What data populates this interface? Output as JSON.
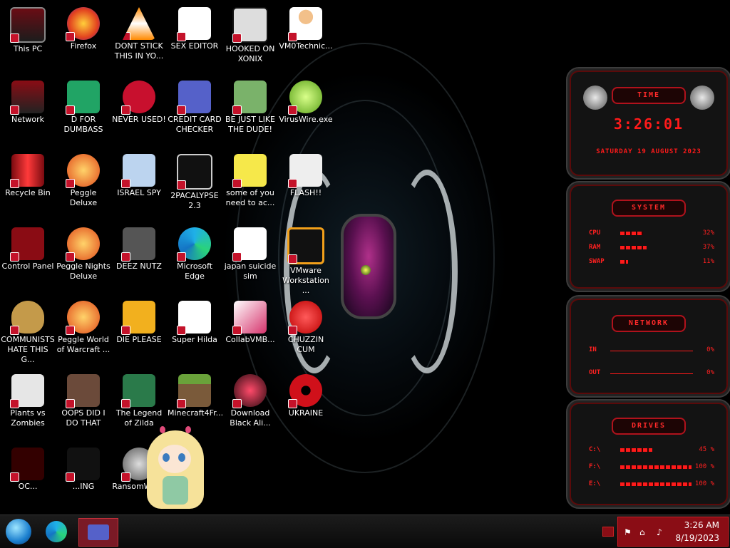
{
  "desktop": {
    "icons": [
      {
        "label": "This PC",
        "art": "monitor"
      },
      {
        "label": "Firefox",
        "art": "firefox"
      },
      {
        "label": "DONT STICK THIS IN YO...",
        "art": "vlc"
      },
      {
        "label": "SEX EDITOR",
        "art": "hxd"
      },
      {
        "label": "HOOKED ON XONIX",
        "art": "xonix"
      },
      {
        "label": "VM0Technic...",
        "art": "person"
      },
      {
        "label": "Network",
        "art": "network"
      },
      {
        "label": "D FOR DUMBASS",
        "art": "sheets"
      },
      {
        "label": "NEVER USED!",
        "art": "dev"
      },
      {
        "label": "CREDIT CARD CHECKER",
        "art": "card"
      },
      {
        "label": "BE JUST LIKE THE DUDE!",
        "art": "elf"
      },
      {
        "label": "VirusWire.exe",
        "art": "lime"
      },
      {
        "label": "Recycle Bin",
        "art": "bin"
      },
      {
        "label": "Peggle Deluxe",
        "art": "peggle"
      },
      {
        "label": "ISRAEL SPY",
        "art": "spy"
      },
      {
        "label": "2PACALYPSE 2.3",
        "art": "cmd"
      },
      {
        "label": "some of you need to ac...",
        "art": "dog"
      },
      {
        "label": "FLASH!!",
        "art": "flash"
      },
      {
        "label": "Control Panel",
        "art": "control"
      },
      {
        "label": "Peggle Nights Deluxe",
        "art": "peggle"
      },
      {
        "label": "DEEZ NUTZ",
        "art": "windows"
      },
      {
        "label": "Microsoft Edge",
        "art": "edge"
      },
      {
        "label": "japan suicide sim",
        "art": "doc"
      },
      {
        "label": "VMware Workstation ...",
        "art": "vmware"
      },
      {
        "label": "COMMUNISTS HATE THIS G...",
        "art": "money"
      },
      {
        "label": "Peggle World of Warcraft ...",
        "art": "peggle"
      },
      {
        "label": "DIE PLEASE",
        "art": "de"
      },
      {
        "label": "Super Hilda",
        "art": "hilda"
      },
      {
        "label": "CollabVMB...",
        "art": "collab"
      },
      {
        "label": "CHUZZIN CUM",
        "art": "chuzzle"
      },
      {
        "label": "Plants vs Zombies",
        "art": "pvz"
      },
      {
        "label": "OOPS DID I DO THAT",
        "art": "portrait"
      },
      {
        "label": "The Legend of Zilda",
        "art": "zelda"
      },
      {
        "label": "Minecraft4Fr...",
        "art": "minecraft"
      },
      {
        "label": "Download Black Ali...",
        "art": "alien"
      },
      {
        "label": "UKRAINE",
        "art": "radiation"
      },
      {
        "label": "OC...",
        "art": "oc"
      },
      {
        "label": "...ING",
        "art": "ing"
      },
      {
        "label": "RansomWar...",
        "art": "skull"
      }
    ]
  },
  "widgets": {
    "time": {
      "title": "TIME",
      "clock": "3:26:01",
      "date": "SATURDAY 19 AUGUST 2023"
    },
    "system": {
      "title": "SYSTEM",
      "rows": [
        {
          "label": "CPU",
          "value": "32%",
          "fraction": 0.32
        },
        {
          "label": "RAM",
          "value": "37%",
          "fraction": 0.37
        },
        {
          "label": "SWAP",
          "value": "11%",
          "fraction": 0.11
        }
      ]
    },
    "network": {
      "title": "NETWORK",
      "rows": [
        {
          "label": "IN",
          "value": "0%"
        },
        {
          "label": "OUT",
          "value": "0%"
        }
      ]
    },
    "drives": {
      "title": "DRIVES",
      "rows": [
        {
          "label": "C:\\",
          "value": "45 %",
          "fraction": 0.45
        },
        {
          "label": "F:\\",
          "value": "100 %",
          "fraction": 1.0
        },
        {
          "label": "E:\\",
          "value": "100 %",
          "fraction": 1.0
        }
      ]
    }
  },
  "taskbar": {
    "start_icon": "start-orb-icon",
    "pinned": [
      {
        "name": "edge-icon"
      },
      {
        "name": "credit-card-checker-icon"
      }
    ],
    "tray": {
      "time": "3:26 AM",
      "date": "8/19/2023"
    }
  },
  "colors": {
    "accent": "#ff1a1a",
    "tray": "#8a0d15"
  }
}
